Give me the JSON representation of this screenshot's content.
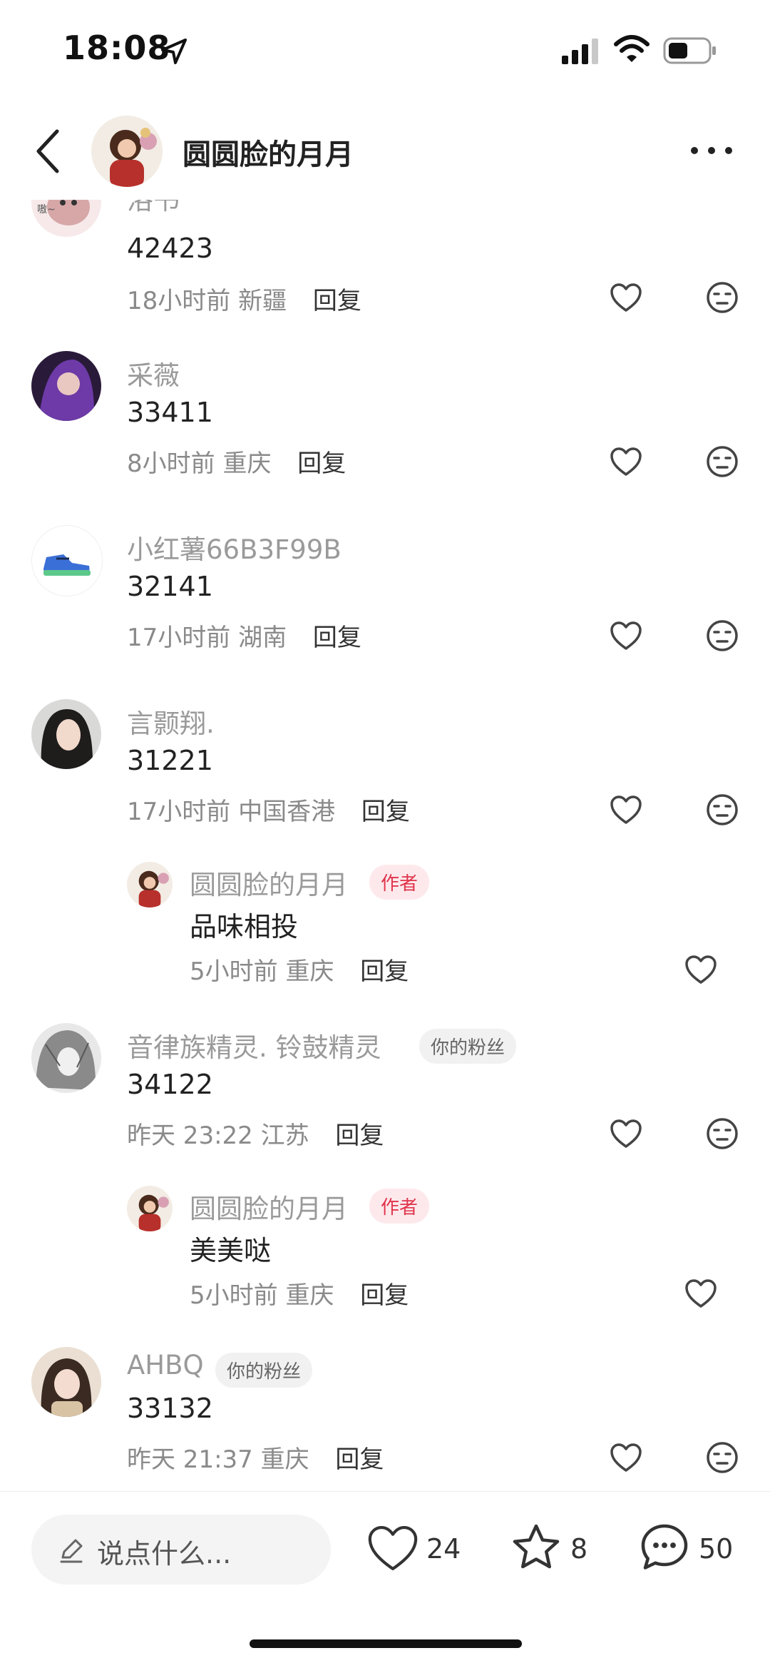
{
  "status_bar": {
    "time": "18:08"
  },
  "header": {
    "title": "圆圆脸的月月"
  },
  "comments": [
    {
      "username": "洛书",
      "text": "42423",
      "time": "18小时前",
      "location": "新疆",
      "reply_label": "回复"
    },
    {
      "username": "采薇",
      "text": "33411",
      "time": "8小时前",
      "location": "重庆",
      "reply_label": "回复"
    },
    {
      "username": "小红薯66B3F99B",
      "text": "32141",
      "time": "17小时前",
      "location": "湖南",
      "reply_label": "回复"
    },
    {
      "username": "言颢翔.",
      "text": "31221",
      "time": "17小时前",
      "location": "中国香港",
      "reply_label": "回复",
      "reply": {
        "username": "圆圆脸的月月",
        "badge": "作者",
        "text": "品味相投",
        "time": "5小时前",
        "location": "重庆",
        "reply_label": "回复"
      }
    },
    {
      "username": "音律族精灵. 铃鼓精灵",
      "badge": "你的粉丝",
      "text": "34122",
      "time": "昨天 23:22",
      "location": "江苏",
      "reply_label": "回复",
      "reply": {
        "username": "圆圆脸的月月",
        "badge": "作者",
        "text": "美美哒",
        "time": "5小时前",
        "location": "重庆",
        "reply_label": "回复"
      }
    },
    {
      "username": "AHBQ",
      "badge": "你的粉丝",
      "text": "33132",
      "time": "昨天 21:37",
      "location": "重庆",
      "reply_label": "回复"
    }
  ],
  "bottom_bar": {
    "input_placeholder": "说点什么...",
    "likes": "24",
    "favorites": "8",
    "comments": "50"
  }
}
